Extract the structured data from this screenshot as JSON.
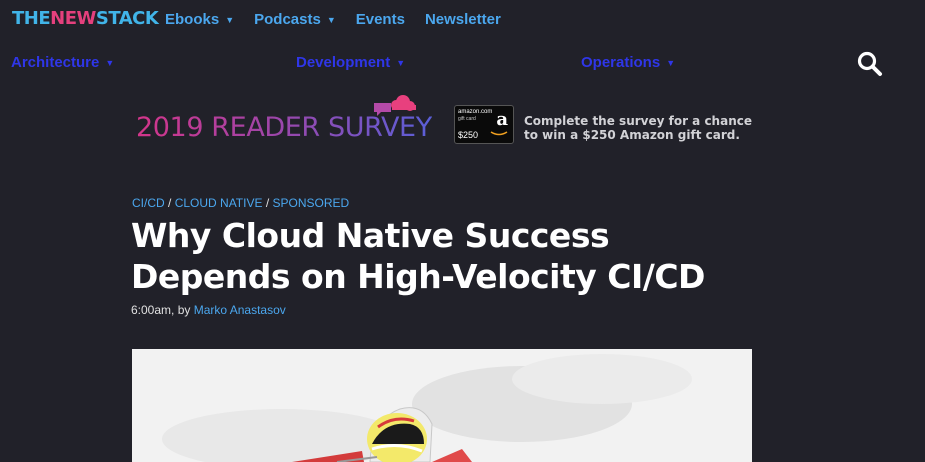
{
  "logo": {
    "part1": "THE",
    "part2": "NEW",
    "part3": "STACK"
  },
  "nav": {
    "top": [
      {
        "label": "Ebooks",
        "dropdown": true
      },
      {
        "label": "Podcasts",
        "dropdown": true
      },
      {
        "label": "Events",
        "dropdown": false
      },
      {
        "label": "Newsletter",
        "dropdown": false
      }
    ],
    "sub": [
      {
        "label": "Architecture"
      },
      {
        "label": "Development"
      },
      {
        "label": "Operations"
      }
    ],
    "caret": "▼"
  },
  "banner": {
    "title": "2019 READER SURVEY",
    "card_brand": "amazon.com",
    "card_sub": "gift card",
    "card_amount": "$250",
    "card_logo": "a",
    "text": "Complete the survey for a chance to win a $250 Amazon gift card."
  },
  "article": {
    "categories": [
      "CI/CD",
      "CLOUD NATIVE",
      "SPONSORED"
    ],
    "separator": " / ",
    "title": "Why Cloud Native Success Depends on High-Velocity CI/CD",
    "time": "6:00am, by ",
    "author": "Marko Anastasov"
  },
  "colors": {
    "background": "#212129",
    "link": "#4ba7ee",
    "subnav": "#2f36e8"
  },
  "icons": {
    "search": "search-icon",
    "cloud": "speech-cloud-icon",
    "amazon": "amazon-logo-icon"
  }
}
